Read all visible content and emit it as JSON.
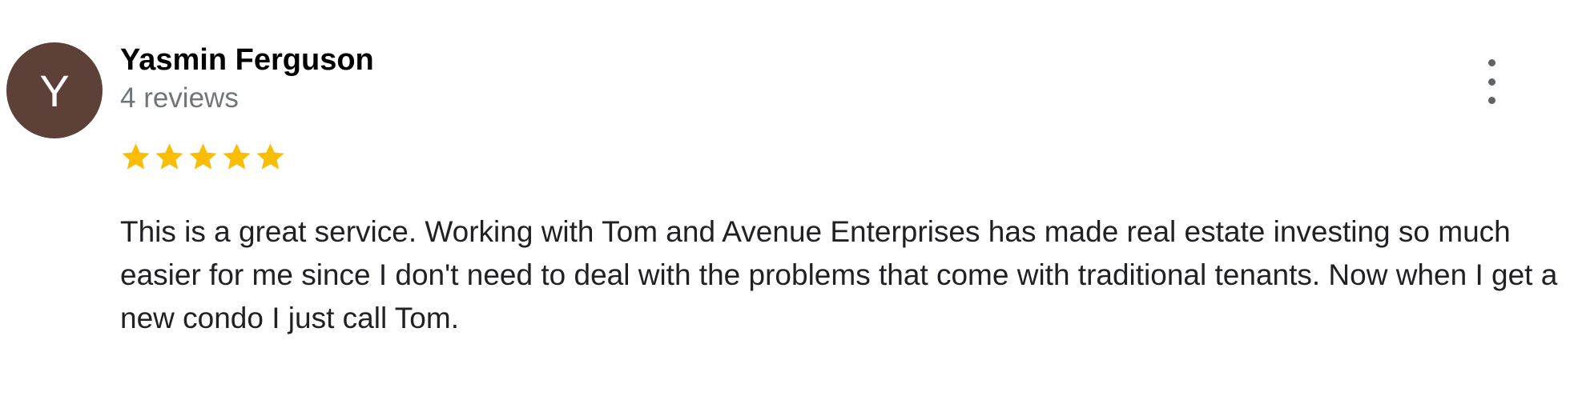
{
  "reviewer": {
    "initial": "Y",
    "name": "Yasmin Ferguson",
    "review_count": "4 reviews",
    "avatar_color": "#5d4037"
  },
  "menu": {
    "icon": "more-vert-icon"
  },
  "rating": {
    "stars": 5,
    "max": 5,
    "star_color": "#fbbc04"
  },
  "review": {
    "text": "This is a great service. Working with Tom and Avenue Enterprises has made real estate investing so much easier for me since I don't need to deal with the problems that come with traditional tenants. Now when I get a new condo I just call Tom."
  }
}
